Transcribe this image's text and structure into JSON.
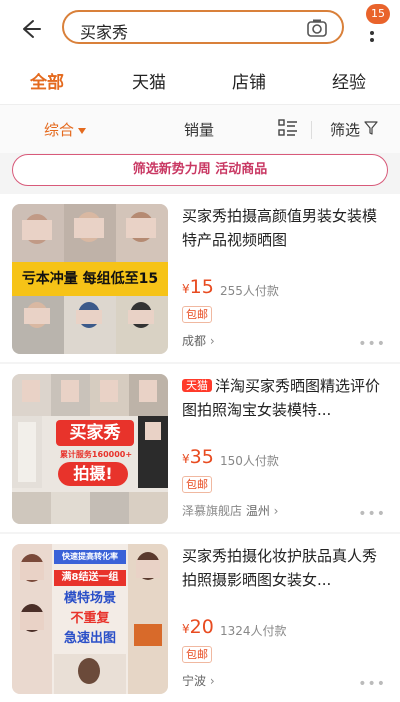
{
  "header": {
    "search_query": "买家秀",
    "badge_count": "15",
    "back_icon": "arrow-left-icon",
    "camera_icon": "camera-icon",
    "more_icon": "more-vertical-icon"
  },
  "tabs": [
    {
      "label": "全部",
      "active": true
    },
    {
      "label": "天猫",
      "active": false
    },
    {
      "label": "店铺",
      "active": false
    },
    {
      "label": "经验",
      "active": false
    }
  ],
  "sort": {
    "comprehensive": "综合",
    "sales": "销量",
    "filter": "筛选"
  },
  "promo_banner": "筛选新势力周 活动商品",
  "products": [
    {
      "title": "买家秀拍摄高颜值男装女装模特产品视频晒图",
      "tmall": false,
      "currency": "¥",
      "price": "15",
      "sold": "255人付款",
      "tag": "包邮",
      "shop": "",
      "city": "成都",
      "thumb_text": "亏本冲量 每组低至15"
    },
    {
      "title": "洋淘买家秀晒图精选评价图拍照淘宝女装模特...",
      "tmall": true,
      "tmall_label": "天猫",
      "currency": "¥",
      "price": "35",
      "sold": "150人付款",
      "tag": "包邮",
      "shop": "泽慕旗舰店",
      "city": "温州",
      "thumb_text": [
        "买家秀",
        "累计服务160000+",
        "拍摄!"
      ]
    },
    {
      "title": "买家秀拍摄化妆护肤品真人秀拍照摄影晒图女装女...",
      "tmall": false,
      "currency": "¥",
      "price": "20",
      "sold": "1324人付款",
      "tag": "包邮",
      "shop": "",
      "city": "宁波",
      "thumb_text": [
        "快速提高转化率",
        "满8结送一组",
        "模特场景",
        "不重复",
        "急速出图"
      ]
    }
  ],
  "colors": {
    "accent": "#e46a1e",
    "price": "#e84b20",
    "promo": "#c93863",
    "tmall": "#ff3a2a"
  }
}
